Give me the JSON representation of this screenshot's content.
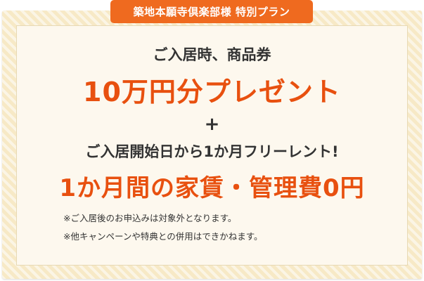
{
  "tag": "築地本願寺倶楽部様 特別プラン",
  "offer1_intro": "ご入居時、商品券",
  "offer1_main": "10万円分プレゼント",
  "plus": "+",
  "offer2_intro": "ご入居開始日から1か月フリーレント!",
  "offer2_main": "1か月間の家賃・管理費0円",
  "notes": [
    "※ご入居後のお申込みは対象外となります。",
    "※他キャンペーンや特典との併用はできかねます。"
  ],
  "colors": {
    "accent": "#ef6a1f",
    "headline": "#e8500f",
    "frame": "#f7e9c6",
    "panel": "#fdf8ee",
    "text": "#333333"
  }
}
